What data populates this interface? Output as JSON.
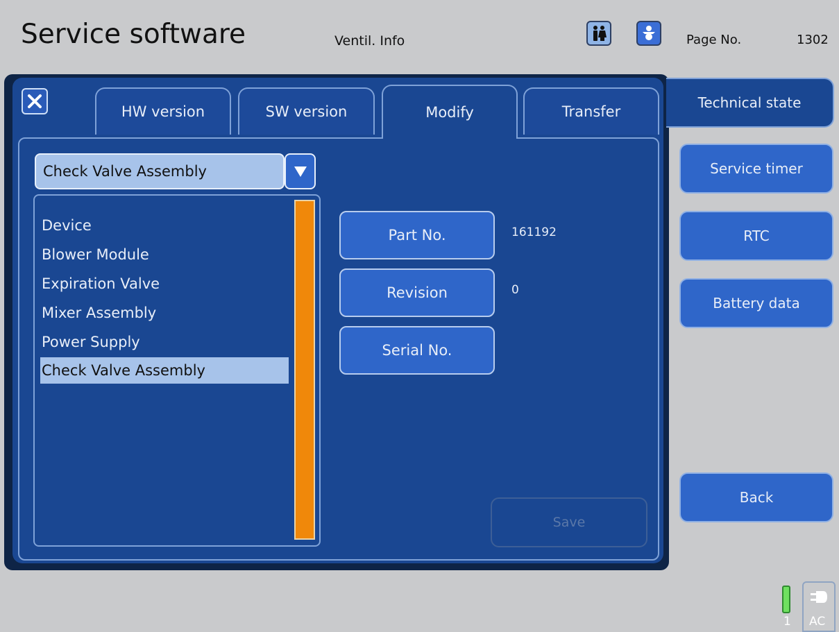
{
  "header": {
    "app_title": "Service software",
    "subtitle": "Ventil. Info",
    "page_label": "Page No.",
    "page_number": "1302",
    "adult_icon": "adult-patients-icon",
    "infant_icon": "infant-patient-icon"
  },
  "tabs": [
    {
      "label": "HW version"
    },
    {
      "label": "SW version"
    },
    {
      "label": "Modify",
      "active": true
    },
    {
      "label": "Transfer"
    }
  ],
  "close_icon": "close-icon",
  "dropdown": {
    "selected": "Check Valve Assembly",
    "icon": "triangle-down-icon"
  },
  "list": {
    "items": [
      "Device",
      "Blower Module",
      "Expiration Valve",
      "Mixer Assembly",
      "Power Supply",
      "Check Valve Assembly"
    ],
    "selected_index": 5
  },
  "fields": [
    {
      "label": "Part No.",
      "value": "161192"
    },
    {
      "label": "Revision",
      "value": "0"
    },
    {
      "label": "Serial No.",
      "value": ""
    }
  ],
  "save_label": "Save",
  "side": {
    "technical_state": "Technical state",
    "service_timer": "Service timer",
    "rtc": "RTC",
    "battery_data": "Battery data",
    "back": "Back"
  },
  "status": {
    "battery_label": "1",
    "ac_label": "AC",
    "battery_icon": "battery-icon",
    "plug_icon": "plug-icon"
  },
  "colors": {
    "background": "#c9cacc",
    "panel": "#1a4792",
    "button": "#2f66c9",
    "scrollbar": "#f0880a",
    "selection": "#a7c3ea"
  }
}
